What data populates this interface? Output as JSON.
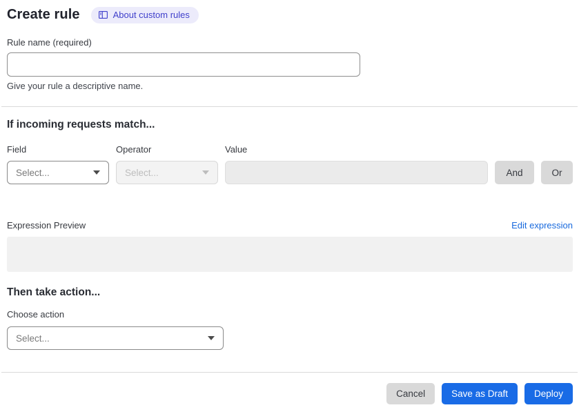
{
  "header": {
    "title": "Create rule",
    "about_label": "About custom rules"
  },
  "rule_name": {
    "label": "Rule name (required)",
    "value": "",
    "placeholder": "",
    "help": "Give your rule a descriptive name."
  },
  "match": {
    "heading": "If incoming requests match...",
    "field_label": "Field",
    "operator_label": "Operator",
    "value_label": "Value",
    "field_placeholder": "Select...",
    "operator_placeholder": "Select...",
    "value_value": "",
    "and_label": "And",
    "or_label": "Or"
  },
  "expression": {
    "preview_label": "Expression Preview",
    "edit_label": "Edit expression",
    "value": ""
  },
  "action": {
    "heading": "Then take action...",
    "choose_label": "Choose action",
    "placeholder": "Select..."
  },
  "footer": {
    "cancel": "Cancel",
    "save_draft": "Save as Draft",
    "deploy": "Deploy"
  },
  "colors": {
    "primary_button_blue": "#196be6",
    "link_blue": "#1668dd",
    "badge_background": "#ecebfb",
    "badge_text": "#3f3fcb",
    "disabled_gray": "#f3f3f3",
    "neutral_button_gray": "#d9d9d9"
  }
}
